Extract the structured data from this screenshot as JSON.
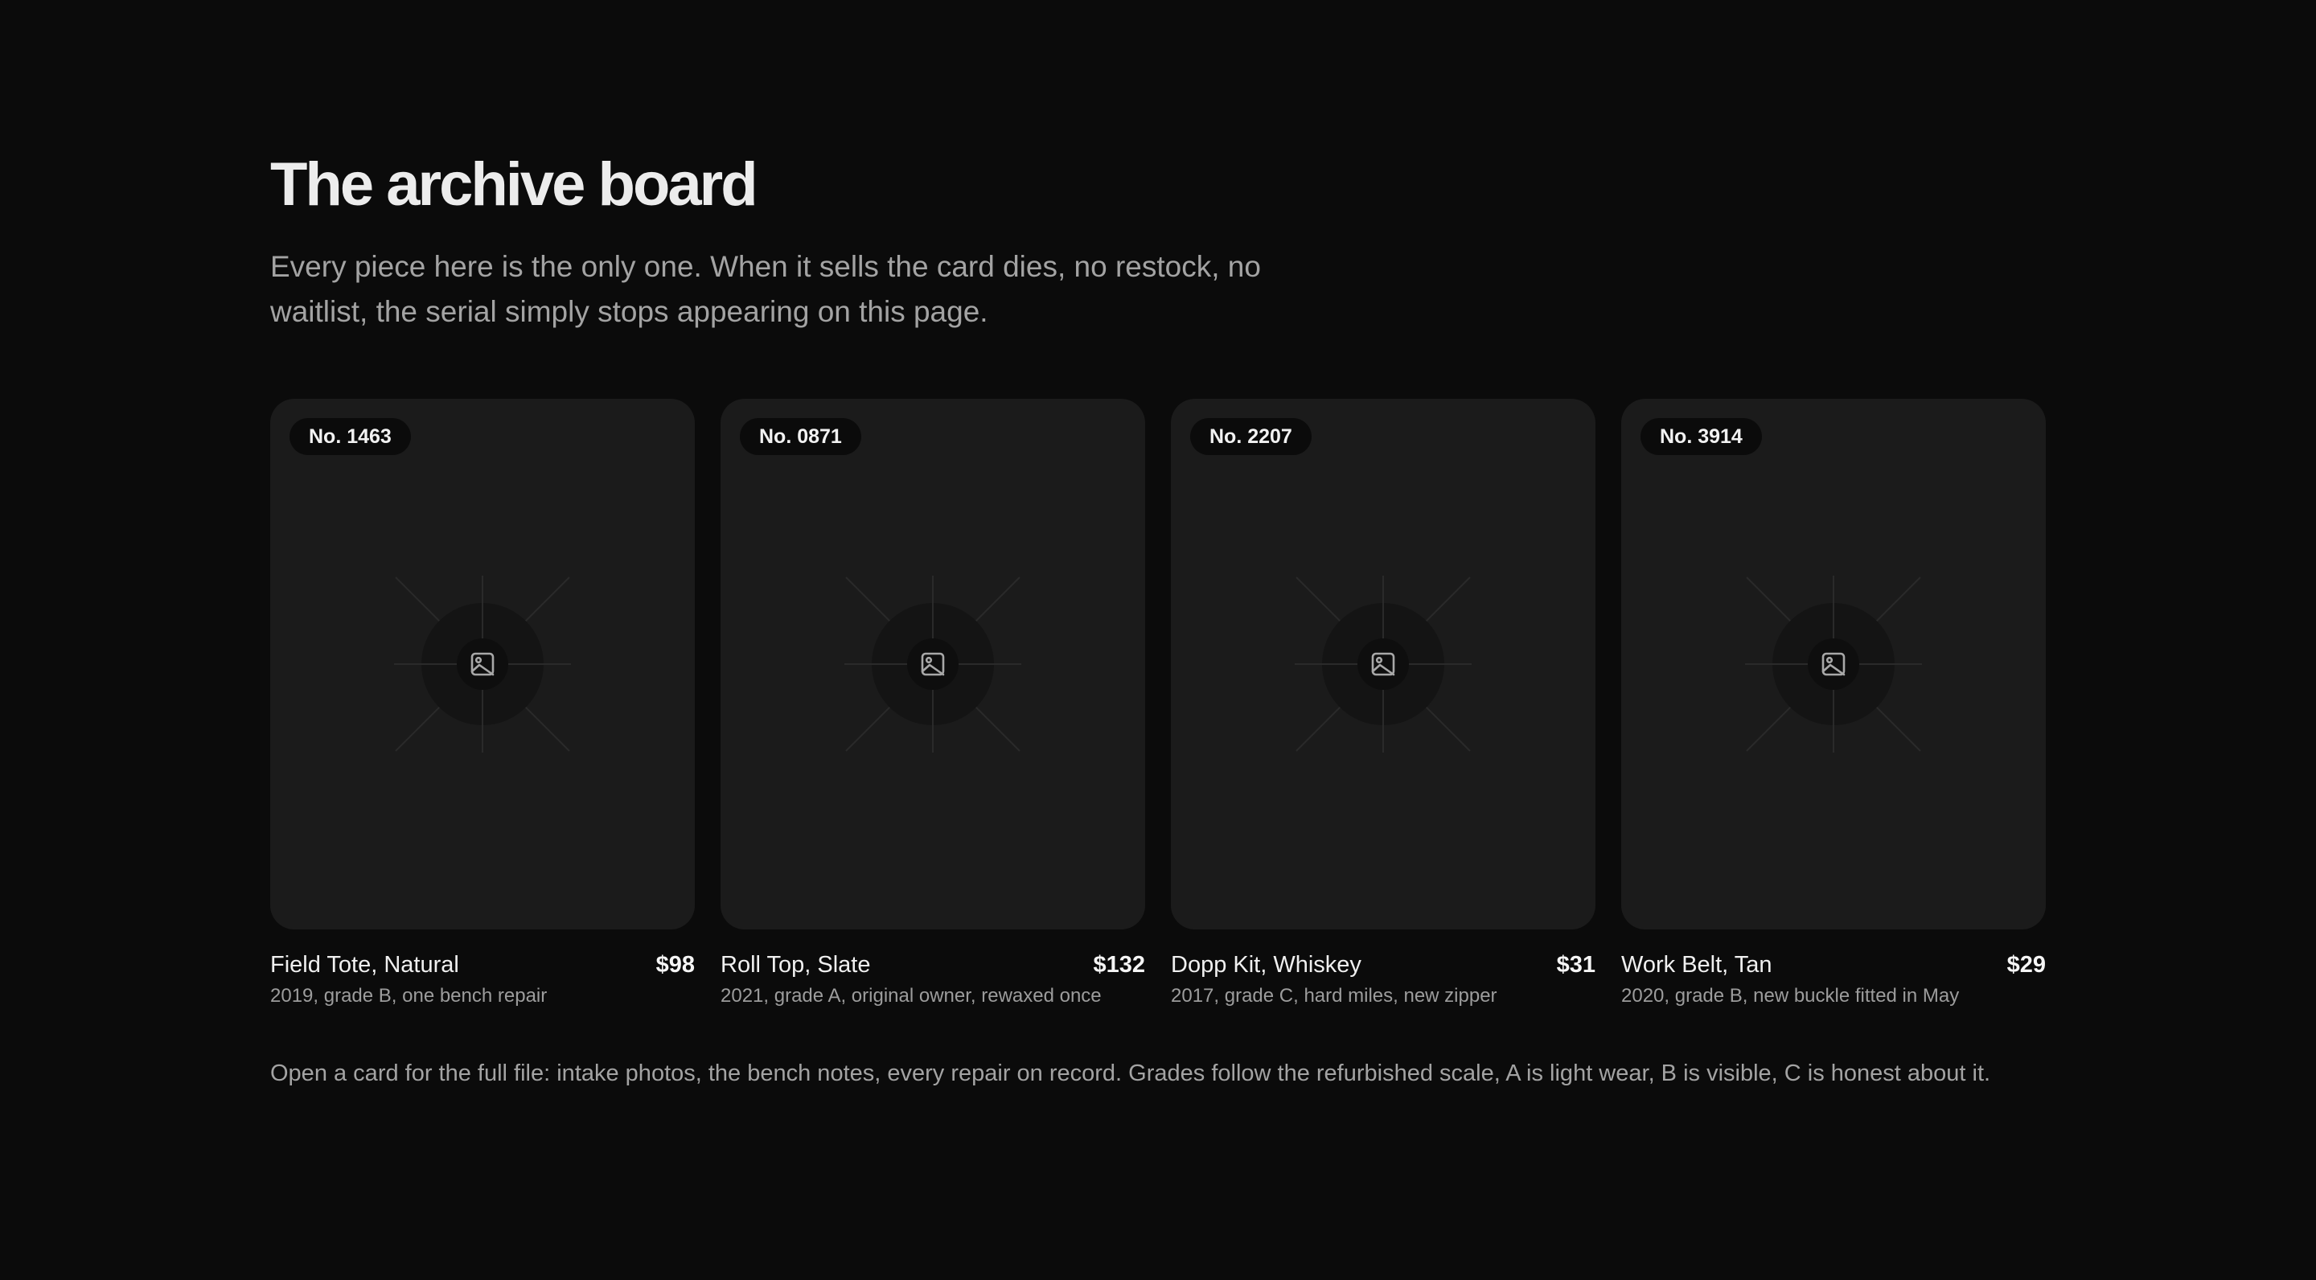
{
  "header": {
    "title": "The archive board",
    "intro": "Every piece here is the only one. When it sells the card dies, no restock, no waitlist, the serial simply stops appearing on this page."
  },
  "cards": [
    {
      "serial": "No. 1463",
      "name": "Field Tote, Natural",
      "price": "$98",
      "detail": "2019, grade B, one bench repair",
      "icon": "image-icon"
    },
    {
      "serial": "No. 0871",
      "name": "Roll Top, Slate",
      "price": "$132",
      "detail": "2021, grade A, original owner, rewaxed once",
      "icon": "image-icon"
    },
    {
      "serial": "No. 2207",
      "name": "Dopp Kit, Whiskey",
      "price": "$31",
      "detail": "2017, grade C, hard miles, new zipper",
      "icon": "image-icon"
    },
    {
      "serial": "No. 3914",
      "name": "Work Belt, Tan",
      "price": "$29",
      "detail": "2020, grade B, new buckle fitted in May",
      "icon": "image-icon"
    }
  ],
  "footnote": "Open a card for the full file: intake photos, the bench notes, every repair on record. Grades follow the refurbished scale, A is light wear, B is visible, C is honest about it.",
  "colors": {
    "background": "#0b0b0b",
    "card": "#1b1b1b",
    "badge": "#0b0b0b",
    "text": "#ececec",
    "muted": "#a3a3a3"
  }
}
